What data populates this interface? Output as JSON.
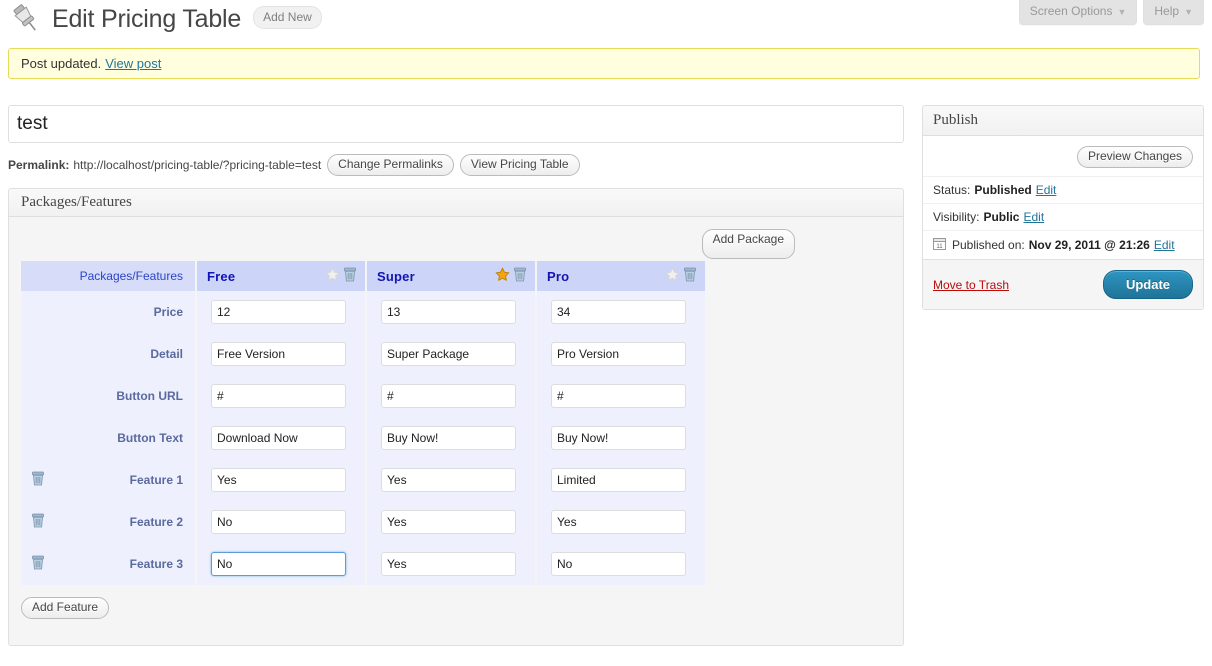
{
  "screen_meta": [
    {
      "label": "Screen Options",
      "caret": "▼"
    },
    {
      "label": "Help",
      "caret": "▼"
    }
  ],
  "header": {
    "icon": "pushpin-icon",
    "title": "Edit Pricing Table",
    "add_new_label": "Add New"
  },
  "notice": {
    "text": "Post updated.",
    "link_label": "View post"
  },
  "editor": {
    "title_value": "test",
    "title_placeholder": "Enter title here",
    "permalink_label": "Permalink:",
    "permalink_url": "http://localhost/pricing-table/?pricing-table=test",
    "change_permalinks_label": "Change Permalinks",
    "view_table_label": "View Pricing Table"
  },
  "metabox": {
    "title": "Packages/Features",
    "add_package_label": "Add Package",
    "add_feature_label": "Add Feature",
    "corner_header": "",
    "row_header_label": "Packages/Features",
    "star_icon": "star-icon",
    "trash_icon": "trash-icon",
    "packages": [
      {
        "name": "Free",
        "featured": false
      },
      {
        "name": "Super",
        "featured": true
      },
      {
        "name": "Pro",
        "featured": false
      }
    ],
    "rows": [
      {
        "label": "Price",
        "deletable": false,
        "values": [
          "12",
          "13",
          "34"
        ]
      },
      {
        "label": "Detail",
        "deletable": false,
        "values": [
          "Free Version",
          "Super Package",
          "Pro Version"
        ]
      },
      {
        "label": "Button URL",
        "deletable": false,
        "values": [
          "#",
          "#",
          "#"
        ]
      },
      {
        "label": "Button Text",
        "deletable": false,
        "values": [
          "Download Now",
          "Buy Now!",
          "Buy Now!"
        ]
      },
      {
        "label": "Feature 1",
        "deletable": true,
        "values": [
          "Yes",
          "Yes",
          "Limited"
        ]
      },
      {
        "label": "Feature 2",
        "deletable": true,
        "values": [
          "No",
          "Yes",
          "Yes"
        ]
      },
      {
        "label": "Feature 3",
        "deletable": true,
        "values": [
          "No",
          "Yes",
          "No"
        ],
        "focused_col": 0
      }
    ]
  },
  "publish": {
    "title": "Publish",
    "preview_label": "Preview Changes",
    "status_label": "Status:",
    "status_value": "Published",
    "status_edit": "Edit",
    "visibility_label": "Visibility:",
    "visibility_value": "Public",
    "visibility_edit": "Edit",
    "published_icon": "calendar-icon",
    "published_label": "Published on:",
    "published_value": "Nov 29, 2011 @ 21:26",
    "published_edit": "Edit",
    "trash_label": "Move to Trash",
    "update_label": "Update"
  },
  "colors": {
    "notice_bg": "#ffffe0",
    "notice_border": "#e6db55",
    "table_header_bg": "#ccd4f7",
    "table_header_label_bg": "#d7ddf9",
    "table_body_bg": "#eef1fd",
    "package_name": "#1414b4",
    "row_label": "#5a6a9e",
    "link": "#21759b",
    "trash_link": "#bc0b0b",
    "update_button": "#1f7497",
    "star_active": "#f2a50c",
    "star_inactive": "#d6d6d6"
  }
}
